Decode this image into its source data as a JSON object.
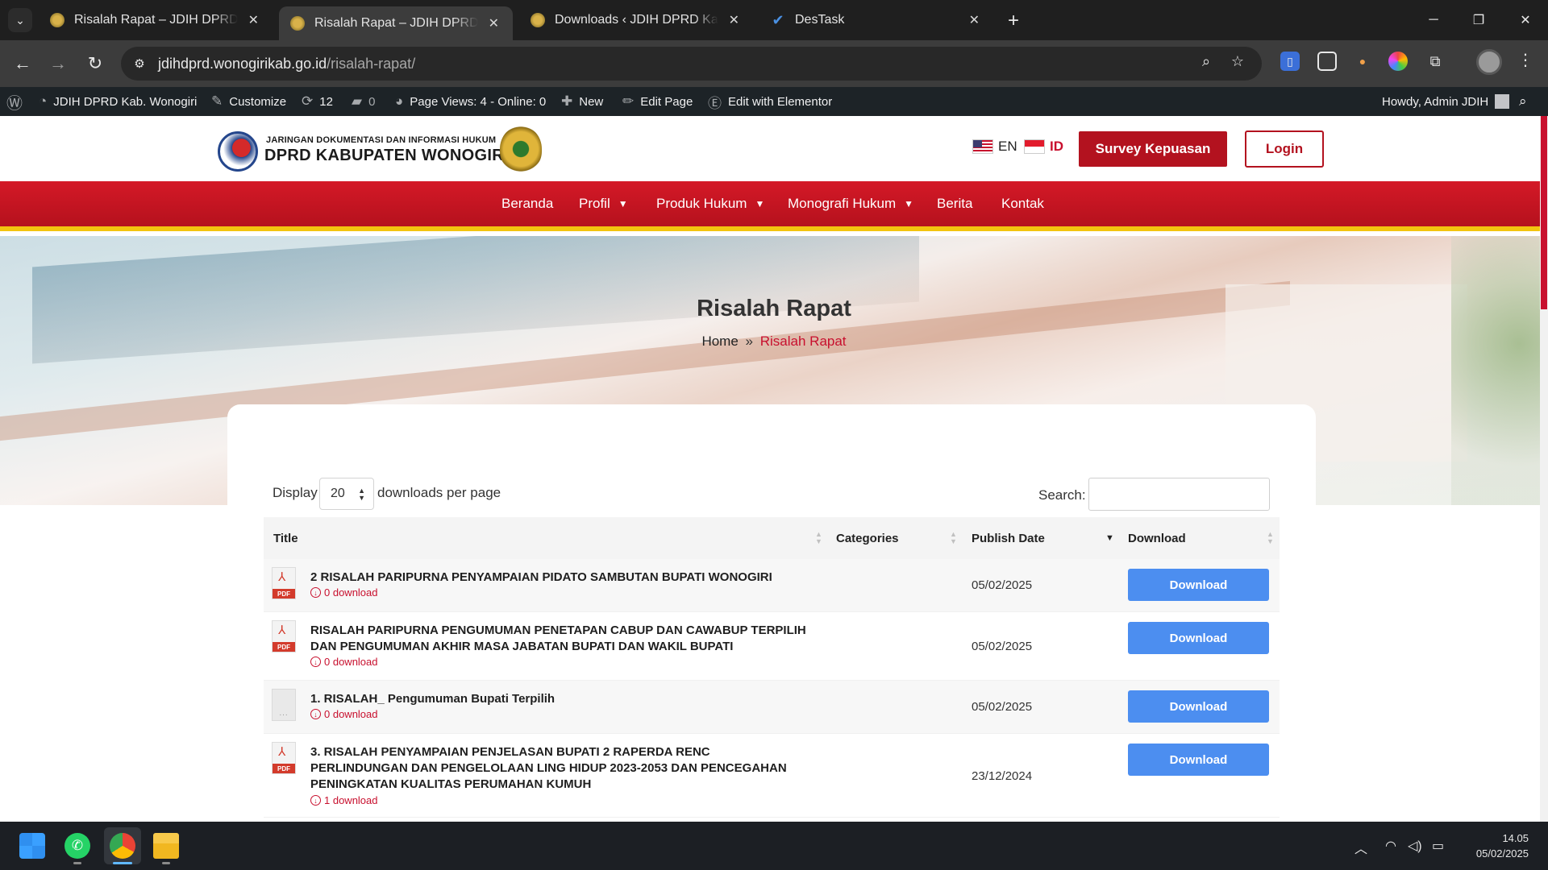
{
  "browser": {
    "tabs": [
      {
        "title": "Risalah Rapat – JDIH DPRD Kab. Wonogiri",
        "active": false
      },
      {
        "title": "Risalah Rapat – JDIH DPRD Kab. Wonogiri",
        "active": true
      },
      {
        "title": "Downloads ‹ JDIH DPRD Kab. Wonogiri",
        "active": false
      },
      {
        "title": "DesTask",
        "active": false
      }
    ],
    "url_host": "jdihdprd.wonogirikab.go.id",
    "url_path": "/risalah-rapat/"
  },
  "adminbar": {
    "site_name": "JDIH DPRD Kab. Wonogiri",
    "customize": "Customize",
    "updates": "12",
    "comments": "0",
    "page_views": "Page Views: 4 - Online: 0",
    "new": "New",
    "edit_page": "Edit Page",
    "edit_elementor": "Edit with Elementor",
    "howdy": "Howdy, Admin JDIH"
  },
  "header": {
    "logo_small": "JARINGAN DOKUMENTASI DAN INFORMASI HUKUM",
    "logo_big": "DPRD KABUPATEN WONOGIRI",
    "lang_en": "EN",
    "lang_id": "ID",
    "survey_button": "Survey Kepuasan",
    "login_button": "Login"
  },
  "nav": {
    "items": [
      "Beranda",
      "Profil",
      "Produk Hukum",
      "Monografi Hukum",
      "Berita",
      "Kontak"
    ]
  },
  "hero": {
    "title": "Risalah Rapat",
    "breadcrumb_home": "Home",
    "breadcrumb_sep": "»",
    "breadcrumb_current": "Risalah Rapat"
  },
  "table_controls": {
    "display_label": "Display",
    "per_page_value": "20",
    "per_page_suffix": "downloads per page",
    "search_label": "Search:"
  },
  "table": {
    "columns": [
      "Title",
      "Categories",
      "Publish Date",
      "Download"
    ],
    "rows": [
      {
        "title": "2 RISALAH PARIPURNA PENYAMPAIAN PIDATO SAMBUTAN BUPATI WONOGIRI",
        "downloads": "0 download",
        "date": "05/02/2025",
        "button": "Download",
        "file_type": "PDF"
      },
      {
        "title": "RISALAH PARIPURNA PENGUMUMAN PENETAPAN CABUP DAN CAWABUP TERPILIH DAN PENGUMUMAN AKHIR MASA JABATAN BUPATI DAN WAKIL BUPATI",
        "downloads": "0 download",
        "date": "05/02/2025",
        "button": "Download",
        "file_type": "PDF"
      },
      {
        "title": "1. RISALAH_ Pengumuman Bupati Terpilih",
        "downloads": "0 download",
        "date": "05/02/2025",
        "button": "Download",
        "file_type": "..."
      },
      {
        "title": "3. RISALAH PENYAMPAIAN PENJELASAN BUPATI 2 RAPERDA RENC PERLINDUNGAN DAN PENGELOLAAN LING HIDUP 2023-2053 DAN PENCEGAHAN PENINGKATAN KUALITAS PERUMAHAN KUMUH",
        "downloads": "1 download",
        "date": "23/12/2024",
        "button": "Download",
        "file_type": "PDF"
      }
    ]
  },
  "taskbar": {
    "time": "14.05",
    "date": "05/02/2025"
  },
  "colors": {
    "brand_red": "#b3121f",
    "accent_yellow": "#f2c40f",
    "download_blue": "#4c8ef0"
  }
}
